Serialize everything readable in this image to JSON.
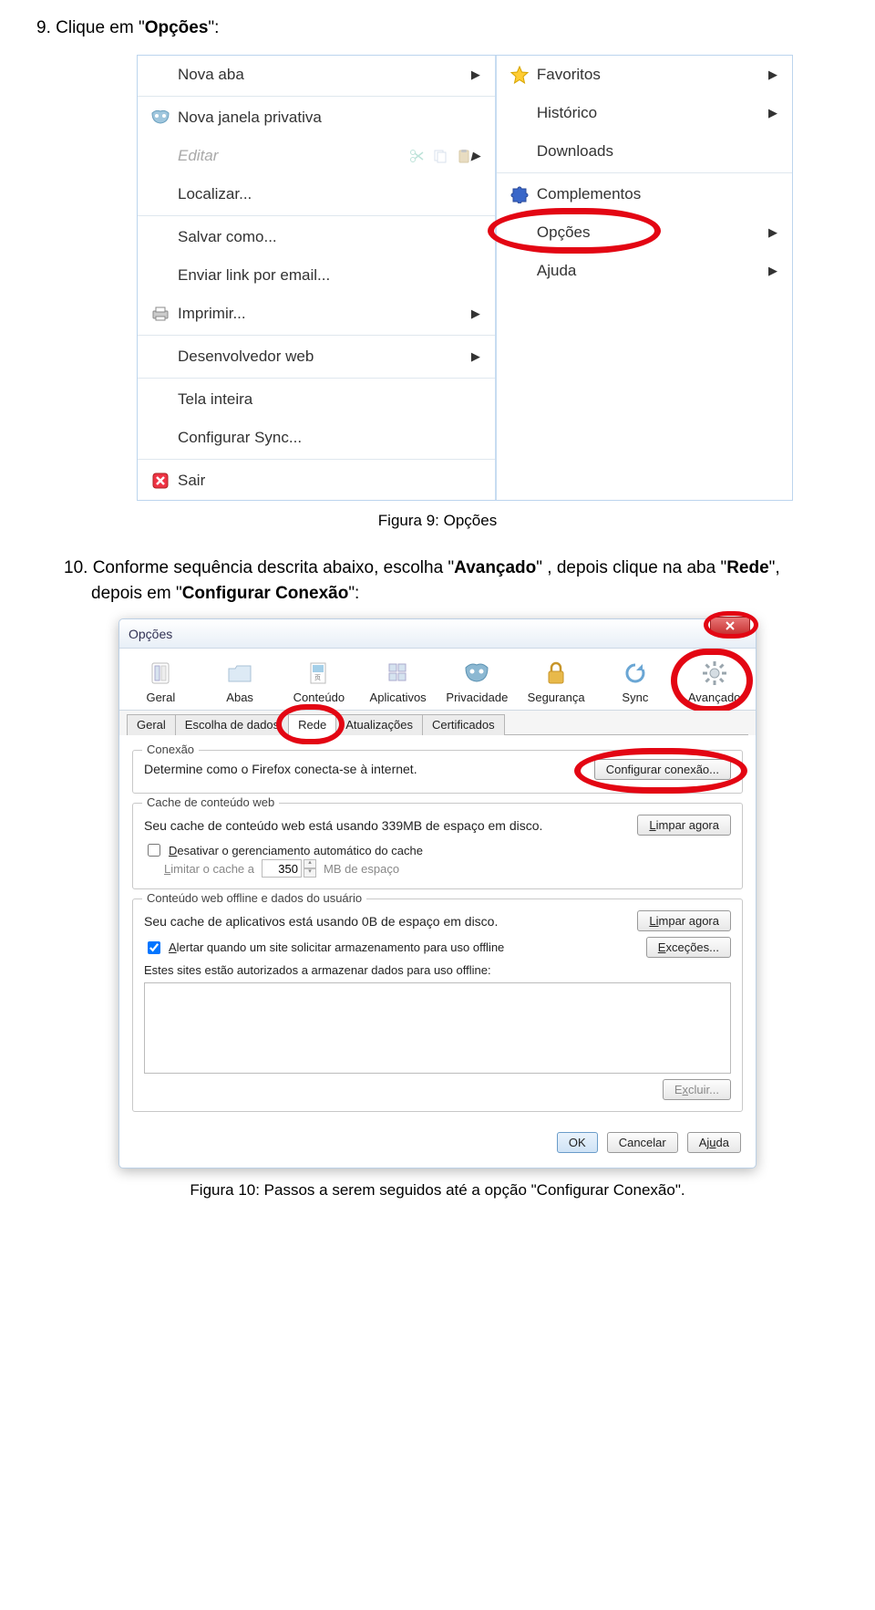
{
  "step9": {
    "num": "9.",
    "text_before": "Clique em \"",
    "keyword": "Opções",
    "text_after": "\":"
  },
  "fig9": {
    "left": [
      {
        "label": "Nova aba",
        "arrow": true,
        "icon": ""
      },
      {
        "label": "Nova janela privativa",
        "icon": "mask"
      },
      {
        "label": "Editar",
        "disabled": true,
        "editicons": true,
        "arrow": true
      },
      {
        "label": "Localizar..."
      },
      {
        "label": "Salvar como..."
      },
      {
        "label": "Enviar link por email..."
      },
      {
        "label": "Imprimir...",
        "icon": "printer",
        "arrow": true
      },
      {
        "label": "Desenvolvedor web",
        "arrow": true
      },
      {
        "label": "Tela inteira"
      },
      {
        "label": "Configurar Sync..."
      },
      {
        "label": "Sair",
        "icon": "closebox"
      }
    ],
    "right": [
      {
        "label": "Favoritos",
        "icon": "star",
        "arrow": true
      },
      {
        "label": "Histórico",
        "arrow": true
      },
      {
        "label": "Downloads"
      },
      {
        "label": "Complementos",
        "icon": "puzzle"
      },
      {
        "label": "Opções",
        "arrow": true,
        "highlight": true
      },
      {
        "label": "Ajuda",
        "arrow": true
      }
    ],
    "caption": "Figura 9: Opções"
  },
  "step10": {
    "num": "10.",
    "line1": "Conforme sequência descrita abaixo, escolha \"",
    "kw1": "Avançado",
    "mid": "\" , depois clique na aba \"",
    "kw2": "Rede",
    "mid2": "\", depois em \"",
    "kw3": "Configurar Conexão",
    "end": "\":"
  },
  "dlg": {
    "title": "Opções",
    "toolbar": [
      {
        "label": "Geral",
        "icon": "switch"
      },
      {
        "label": "Abas",
        "icon": "folder"
      },
      {
        "label": "Conteúdo",
        "icon": "page"
      },
      {
        "label": "Aplicativos",
        "icon": "apps"
      },
      {
        "label": "Privacidade",
        "icon": "mask2"
      },
      {
        "label": "Segurança",
        "icon": "lock"
      },
      {
        "label": "Sync",
        "icon": "sync"
      },
      {
        "label": "Avançado",
        "icon": "gear",
        "highlight": true
      }
    ],
    "tabs": [
      {
        "label": "Geral"
      },
      {
        "label": "Escolha de dados"
      },
      {
        "label": "Rede",
        "active": true,
        "highlight": true
      },
      {
        "label": "Atualizações"
      },
      {
        "label": "Certificados"
      }
    ],
    "conn": {
      "group": "Conexão",
      "text": "Determine como o Firefox conecta-se à internet.",
      "btn": "Configurar conexão..."
    },
    "cache": {
      "group": "Cache de conteúdo web",
      "line1": "Seu cache de conteúdo web está usando 339MB de espaço em disco.",
      "btn": "Limpar agora",
      "chk": "Desativar o gerenciamento automático do cache",
      "limit_label": "Limitar o cache a",
      "limit_val": "350",
      "limit_unit": "MB de espaço"
    },
    "offline": {
      "group": "Conteúdo web offline e dados do usuário",
      "line1": "Seu cache de aplicativos está usando 0B de espaço em disco.",
      "btn1": "Limpar agora",
      "chk": "Alertar quando um site solicitar armazenamento para uso offline",
      "btn2": "Exceções...",
      "line2": "Estes sites estão autorizados a armazenar dados para uso offline:",
      "btn3": "Excluir..."
    },
    "footer": {
      "ok": "OK",
      "cancel": "Cancelar",
      "help": "Ajuda"
    }
  },
  "fig10_caption": "Figura 10: Passos a serem seguidos até a opção \"Configurar Conexão\"."
}
